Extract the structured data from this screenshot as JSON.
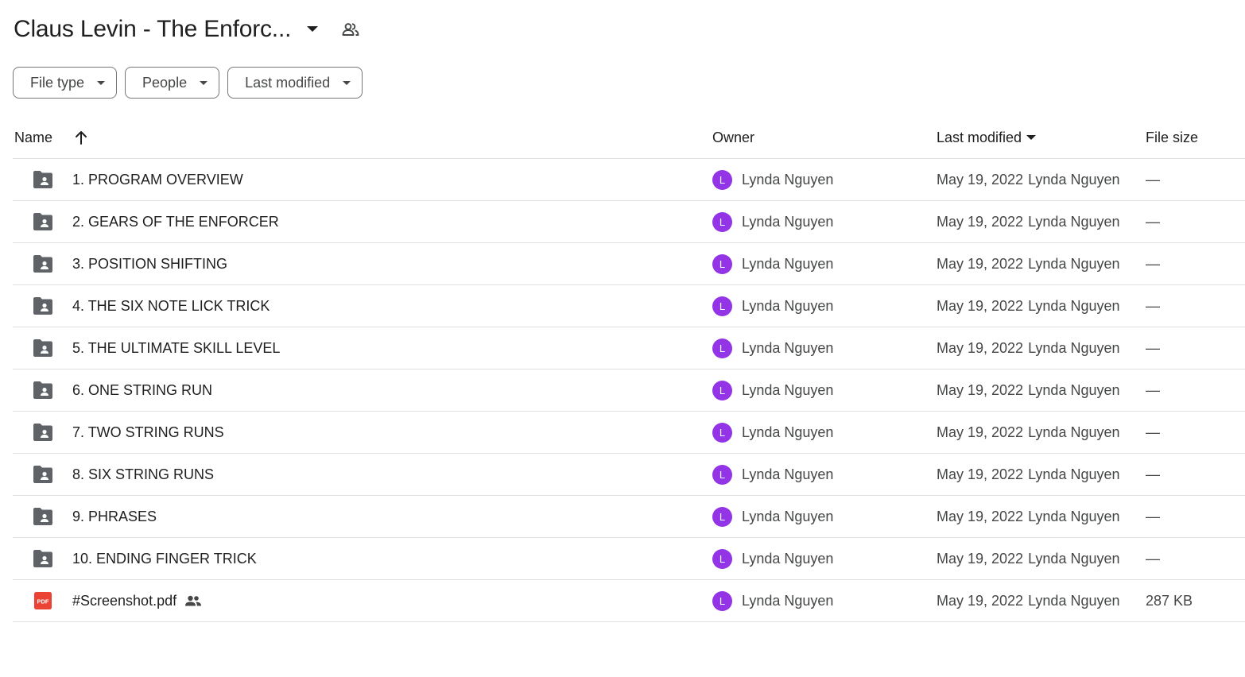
{
  "header": {
    "title": "Claus Levin - The Enforc...",
    "title_caret_icon": "arrow-drop-down-icon",
    "shared_icon": "people-outline-icon"
  },
  "filters": [
    {
      "label": "File type",
      "icon": "arrow-drop-down-icon"
    },
    {
      "label": "People",
      "icon": "arrow-drop-down-icon"
    },
    {
      "label": "Last modified",
      "icon": "arrow-drop-down-icon"
    }
  ],
  "table": {
    "columns": {
      "name": "Name",
      "owner": "Owner",
      "last_modified": "Last modified",
      "file_size": "File size"
    },
    "sort_icon": "arrow-upward-icon",
    "rows": [
      {
        "type": "shared-folder",
        "name": "1. PROGRAM OVERVIEW",
        "owner": "Lynda Nguyen",
        "avatar": "L",
        "date": "May 19, 2022",
        "modified_by": "Lynda Nguyen",
        "size": "—"
      },
      {
        "type": "shared-folder",
        "name": "2. GEARS OF THE ENFORCER",
        "owner": "Lynda Nguyen",
        "avatar": "L",
        "date": "May 19, 2022",
        "modified_by": "Lynda Nguyen",
        "size": "—"
      },
      {
        "type": "shared-folder",
        "name": "3. POSITION SHIFTING",
        "owner": "Lynda Nguyen",
        "avatar": "L",
        "date": "May 19, 2022",
        "modified_by": "Lynda Nguyen",
        "size": "—"
      },
      {
        "type": "shared-folder",
        "name": "4. THE SIX NOTE LICK TRICK",
        "owner": "Lynda Nguyen",
        "avatar": "L",
        "date": "May 19, 2022",
        "modified_by": "Lynda Nguyen",
        "size": "—"
      },
      {
        "type": "shared-folder",
        "name": "5. THE ULTIMATE SKILL LEVEL",
        "owner": "Lynda Nguyen",
        "avatar": "L",
        "date": "May 19, 2022",
        "modified_by": "Lynda Nguyen",
        "size": "—"
      },
      {
        "type": "shared-folder",
        "name": "6. ONE STRING RUN",
        "owner": "Lynda Nguyen",
        "avatar": "L",
        "date": "May 19, 2022",
        "modified_by": "Lynda Nguyen",
        "size": "—"
      },
      {
        "type": "shared-folder",
        "name": "7. TWO STRING RUNS",
        "owner": "Lynda Nguyen",
        "avatar": "L",
        "date": "May 19, 2022",
        "modified_by": "Lynda Nguyen",
        "size": "—"
      },
      {
        "type": "shared-folder",
        "name": "8. SIX STRING RUNS",
        "owner": "Lynda Nguyen",
        "avatar": "L",
        "date": "May 19, 2022",
        "modified_by": "Lynda Nguyen",
        "size": "—"
      },
      {
        "type": "shared-folder",
        "name": "9. PHRASES",
        "owner": "Lynda Nguyen",
        "avatar": "L",
        "date": "May 19, 2022",
        "modified_by": "Lynda Nguyen",
        "size": "—"
      },
      {
        "type": "shared-folder",
        "name": "10. ENDING FINGER TRICK",
        "owner": "Lynda Nguyen",
        "avatar": "L",
        "date": "May 19, 2022",
        "modified_by": "Lynda Nguyen",
        "size": "—"
      },
      {
        "type": "pdf",
        "name": "#Screenshot.pdf",
        "shared": true,
        "owner": "Lynda Nguyen",
        "avatar": "L",
        "date": "May 19, 2022",
        "modified_by": "Lynda Nguyen",
        "size": "287 KB"
      }
    ]
  },
  "colors": {
    "avatar": "#9334e6",
    "pdf": "#ea4335",
    "folder": "#5f6368",
    "divider": "#e0e0e0"
  }
}
